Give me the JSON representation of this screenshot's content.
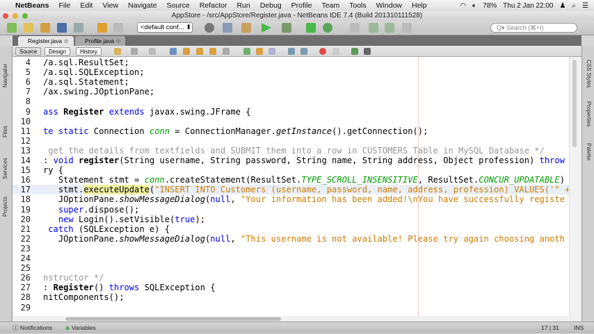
{
  "menubar": {
    "app": "NetBeans",
    "items": [
      "File",
      "Edit",
      "View",
      "Navigate",
      "Source",
      "Refactor",
      "Run",
      "Debug",
      "Profile",
      "Team",
      "Tools",
      "Window",
      "Help"
    ],
    "battery": "78%",
    "clock": "Thu 2 Jan  22:00"
  },
  "window": {
    "title": "AppStore - /src/AppStore/Register.java - NetBeans IDE 7.4 (Build 201310111528)"
  },
  "toolbar": {
    "config": "<default conf... ⬍",
    "search_placeholder": "Q▾ Search (⌘+I)"
  },
  "tabs": [
    {
      "label": "Register.java",
      "active": true
    },
    {
      "label": "Profile.java",
      "active": false
    }
  ],
  "editor_toolbar": {
    "source": "Source",
    "design": "Design",
    "history": "History"
  },
  "left_panels": [
    "Navigator",
    "Files",
    "Services",
    "Projects"
  ],
  "right_panels": [
    "CSS Styles",
    "Properties",
    "Palette"
  ],
  "code": [
    {
      "n": "4",
      "t": [
        [
          "/a.sql.ResultSet;",
          ""
        ]
      ]
    },
    {
      "n": "5",
      "t": [
        [
          "/a.sql.SQLException;",
          ""
        ]
      ]
    },
    {
      "n": "6",
      "t": [
        [
          "/a.sql.Statement;",
          ""
        ]
      ]
    },
    {
      "n": "7",
      "t": [
        [
          "/ax.swing.JOptionPane;",
          ""
        ]
      ]
    },
    {
      "n": "8",
      "t": []
    },
    {
      "n": "9",
      "t": [
        [
          "ass ",
          "kw"
        ],
        [
          "Register",
          "bold"
        ],
        [
          " ",
          ""
        ],
        [
          "extends",
          "kw"
        ],
        [
          " javax.swing.JFrame {",
          ""
        ]
      ]
    },
    {
      "n": "10",
      "t": []
    },
    {
      "n": "11",
      "t": [
        [
          "te static",
          "kw"
        ],
        [
          " Connection ",
          ""
        ],
        [
          "conn",
          "field"
        ],
        [
          " = ConnectionManager.",
          ""
        ],
        [
          "getInstance",
          "ital"
        ],
        [
          "().getConnection();",
          ""
        ]
      ]
    },
    {
      "n": "12",
      "t": []
    },
    {
      "n": "13",
      "t": [
        [
          " get the details from textfields and SUBMIT them into a row in CUSTOMERS Table in MySQL Database */",
          "comment"
        ]
      ]
    },
    {
      "n": "14",
      "t": [
        [
          ": ",
          ""
        ],
        [
          "void",
          "kw"
        ],
        [
          " ",
          ""
        ],
        [
          "register",
          "bold"
        ],
        [
          "(String username, String password, String name, String address, Object profession) ",
          ""
        ],
        [
          "throw",
          "kw"
        ]
      ]
    },
    {
      "n": "15",
      "t": [
        [
          "ry {",
          ""
        ]
      ]
    },
    {
      "n": "16",
      "t": [
        [
          "   Statement stmt = ",
          ""
        ],
        [
          "conn",
          "field"
        ],
        [
          ".createStatement(ResultSet.",
          ""
        ],
        [
          "TYPE_SCROLL_INSENSITIVE",
          "field"
        ],
        [
          ", ResultSet.",
          ""
        ],
        [
          "CONCUR_UPDATABLE",
          "field"
        ],
        [
          ")",
          ""
        ]
      ]
    },
    {
      "n": "17",
      "cur": true,
      "t": [
        [
          "   stmt.",
          ""
        ],
        [
          "executeUpdate",
          "hl"
        ],
        [
          "(",
          ""
        ],
        [
          "\"INSERT INTO Customers (username, password, name, address, profession) VALUES('\" +",
          "str"
        ]
      ]
    },
    {
      "n": "18",
      "t": [
        [
          "   JOptionPane.",
          ""
        ],
        [
          "showMessageDialog",
          "ital"
        ],
        [
          "(",
          ""
        ],
        [
          "null",
          "kw"
        ],
        [
          ", ",
          ""
        ],
        [
          "\"Your information has been added!\\nYou have successfully registe",
          "str"
        ]
      ]
    },
    {
      "n": "19",
      "t": [
        [
          "   ",
          ""
        ],
        [
          "super",
          "kw"
        ],
        [
          ".dispose();",
          ""
        ]
      ]
    },
    {
      "n": "20",
      "t": [
        [
          "   ",
          ""
        ],
        [
          "new",
          "kw"
        ],
        [
          " Login().setVisible(",
          ""
        ],
        [
          "true",
          "kw"
        ],
        [
          ");",
          ""
        ]
      ]
    },
    {
      "n": "21",
      "t": [
        [
          " ",
          ""
        ],
        [
          "catch",
          "kw"
        ],
        [
          " (SQLException e) {",
          ""
        ]
      ]
    },
    {
      "n": "22",
      "t": [
        [
          "   JOptionPane.",
          ""
        ],
        [
          "showMessageDialog",
          "ital"
        ],
        [
          "(",
          ""
        ],
        [
          "null",
          "kw"
        ],
        [
          ", ",
          ""
        ],
        [
          "\"This username is not available! Please try again choosing anoth",
          "str"
        ]
      ]
    },
    {
      "n": "23",
      "t": []
    },
    {
      "n": "24",
      "t": []
    },
    {
      "n": "25",
      "t": []
    },
    {
      "n": "26",
      "t": [
        [
          "nstructor */",
          "comment"
        ]
      ]
    },
    {
      "n": "27",
      "t": [
        [
          ": ",
          ""
        ],
        [
          "Register",
          "bold"
        ],
        [
          "() ",
          ""
        ],
        [
          "throws",
          "kw"
        ],
        [
          " SQLException {",
          ""
        ]
      ]
    },
    {
      "n": "28",
      "t": [
        [
          "nitComponents();",
          ""
        ]
      ]
    },
    {
      "n": "29",
      "t": []
    }
  ],
  "status": {
    "notifications": "Notifications",
    "variables": "Variables",
    "position": "17 | 31",
    "mode": "INS"
  }
}
